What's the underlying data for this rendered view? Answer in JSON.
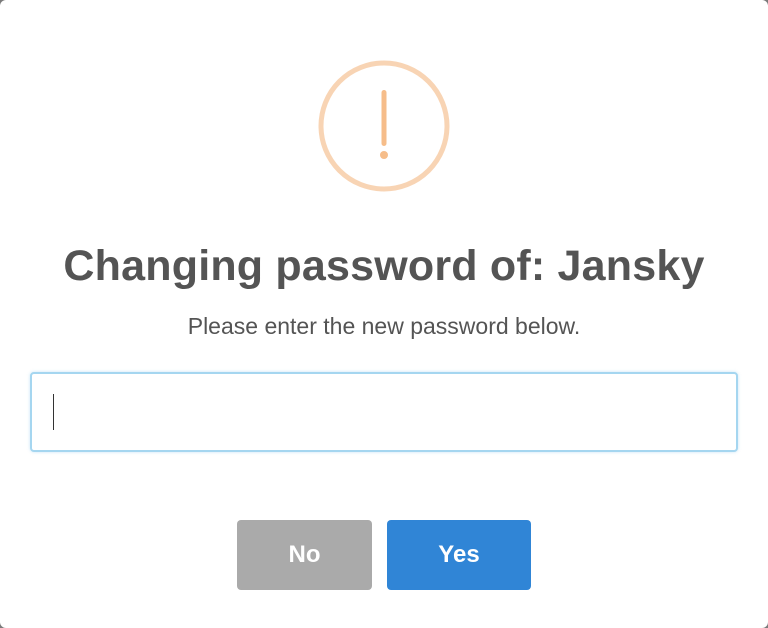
{
  "dialog": {
    "title": "Changing password of: Jansky",
    "message": "Please enter the new password below.",
    "icon": "warning-icon",
    "icon_color": "#f8bb86"
  },
  "password_input": {
    "value": "",
    "placeholder": ""
  },
  "buttons": {
    "no_label": "No",
    "yes_label": "Yes",
    "no_color": "#aaaaaa",
    "yes_color": "#3085d6"
  }
}
